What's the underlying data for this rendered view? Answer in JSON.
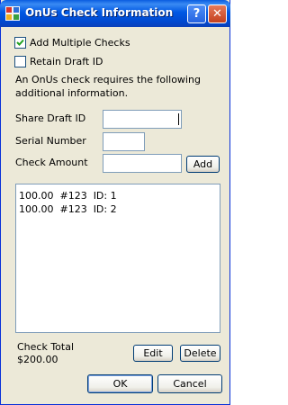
{
  "window": {
    "title": "OnUs Check Information",
    "help_label": "?",
    "close_label": "✕"
  },
  "options": {
    "add_multiple_label": "Add Multiple Checks",
    "add_multiple_checked": true,
    "retain_draft_label": "Retain Draft ID",
    "retain_draft_checked": false
  },
  "info_text_line1": "An OnUs check requires the following",
  "info_text_line2": "additional information.",
  "fields": {
    "share_draft_label": "Share Draft ID",
    "share_draft_value": "",
    "serial_label": "Serial Number",
    "serial_value": "",
    "amount_label": "Check Amount",
    "amount_value": ""
  },
  "add_label": "Add",
  "checks": [
    {
      "text": "100.00  #123  ID: 1"
    },
    {
      "text": "100.00  #123  ID: 2"
    }
  ],
  "total": {
    "label": "Check Total",
    "value": "$200.00"
  },
  "edit_label": "Edit",
  "delete_label": "Delete",
  "ok_label": "OK",
  "cancel_label": "Cancel"
}
